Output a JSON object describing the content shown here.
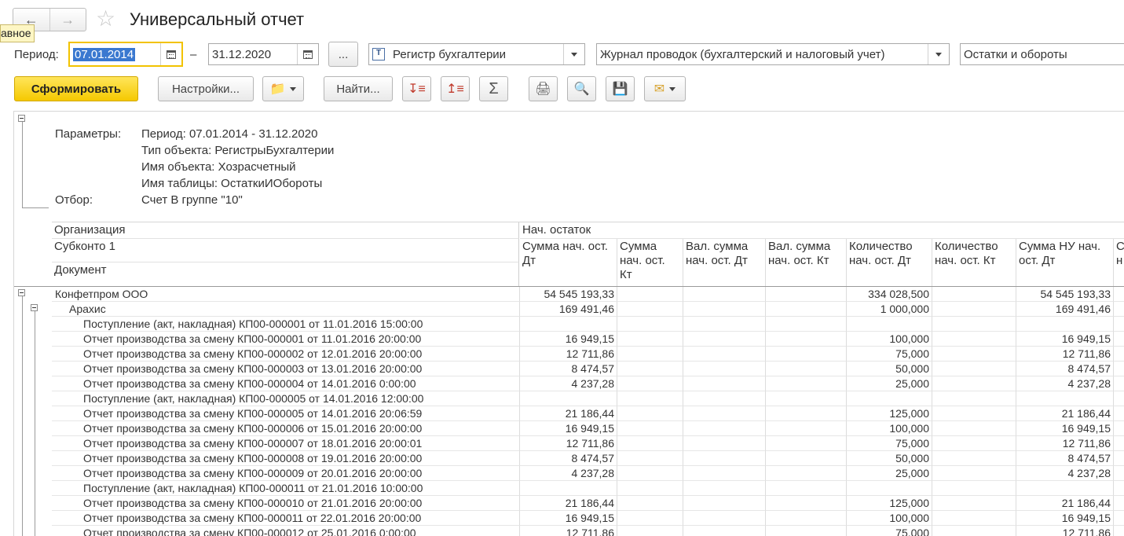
{
  "window": {
    "title": "Универсальный отчет",
    "tooltip": "авное"
  },
  "icons": {
    "back": "arrow-left-icon",
    "forward": "arrow-right-icon",
    "favorite": "star-icon"
  },
  "period": {
    "label": "Период:",
    "from": "07.01.2014",
    "dash": "–",
    "to": "31.12.2020",
    "more_label": "..."
  },
  "selectors": {
    "object_type": "Регистр бухгалтерии",
    "object": "Журнал проводок (бухгалтерский и налоговый учет)",
    "table": "Остатки и обороты"
  },
  "toolbar": {
    "generate": "Сформировать",
    "settings": "Настройки...",
    "find": "Найти..."
  },
  "params": {
    "params_label": "Параметры:",
    "filter_label": "Отбор:",
    "lines": [
      "Период: 07.01.2014 - 31.12.2020",
      "Тип объекта: РегистрыБухгалтерии",
      "Имя объекта: Хозрасчетный",
      "Имя таблицы: ОстаткиИОбороты"
    ],
    "filter": "Счет В группе \"10\""
  },
  "header": {
    "org": "Организация",
    "subkonto": "Субконто 1",
    "document": "Документ",
    "group": "Нач. остаток",
    "columns": [
      "Сумма нач. ост. Дт",
      "Сумма нач. ост. Кт",
      "Вал. сумма нач. ост. Дт",
      "Вал. сумма нач. ост. Кт",
      "Количество нач. ост. Дт",
      "Количество нач. ост. Кт",
      "Сумма НУ нач. ост. Дт",
      "С н"
    ]
  },
  "rows": [
    {
      "name": "Конфетпром ООО",
      "level": 0,
      "sum": "54 545 193,33",
      "qty": "334 028,500",
      "nu": "54 545 193,33"
    },
    {
      "name": "Арахис",
      "level": 1,
      "sum": "169 491,46",
      "qty": "1 000,000",
      "nu": "169 491,46"
    },
    {
      "name": "Поступление (акт, накладная) КП00-000001 от 11.01.2016 15:00:00",
      "level": 2,
      "sum": "",
      "qty": "",
      "nu": ""
    },
    {
      "name": "Отчет производства за смену КП00-000001 от 11.01.2016 20:00:00",
      "level": 2,
      "sum": "16 949,15",
      "qty": "100,000",
      "nu": "16 949,15"
    },
    {
      "name": "Отчет производства за смену КП00-000002 от 12.01.2016 20:00:00",
      "level": 2,
      "sum": "12 711,86",
      "qty": "75,000",
      "nu": "12 711,86"
    },
    {
      "name": "Отчет производства за смену КП00-000003 от 13.01.2016 20:00:00",
      "level": 2,
      "sum": "8 474,57",
      "qty": "50,000",
      "nu": "8 474,57"
    },
    {
      "name": "Отчет производства за смену КП00-000004 от 14.01.2016 0:00:00",
      "level": 2,
      "sum": "4 237,28",
      "qty": "25,000",
      "nu": "4 237,28"
    },
    {
      "name": "Поступление (акт, накладная) КП00-000005 от 14.01.2016 12:00:00",
      "level": 2,
      "sum": "",
      "qty": "",
      "nu": ""
    },
    {
      "name": "Отчет производства за смену КП00-000005 от 14.01.2016 20:06:59",
      "level": 2,
      "sum": "21 186,44",
      "qty": "125,000",
      "nu": "21 186,44"
    },
    {
      "name": "Отчет производства за смену КП00-000006 от 15.01.2016 20:00:00",
      "level": 2,
      "sum": "16 949,15",
      "qty": "100,000",
      "nu": "16 949,15"
    },
    {
      "name": "Отчет производства за смену КП00-000007 от 18.01.2016 20:00:01",
      "level": 2,
      "sum": "12 711,86",
      "qty": "75,000",
      "nu": "12 711,86"
    },
    {
      "name": "Отчет производства за смену КП00-000008 от 19.01.2016 20:00:00",
      "level": 2,
      "sum": "8 474,57",
      "qty": "50,000",
      "nu": "8 474,57"
    },
    {
      "name": "Отчет производства за смену КП00-000009 от 20.01.2016 20:00:00",
      "level": 2,
      "sum": "4 237,28",
      "qty": "25,000",
      "nu": "4 237,28"
    },
    {
      "name": "Поступление (акт, накладная) КП00-000011 от 21.01.2016 10:00:00",
      "level": 2,
      "sum": "",
      "qty": "",
      "nu": ""
    },
    {
      "name": "Отчет производства за смену КП00-000010 от 21.01.2016 20:00:00",
      "level": 2,
      "sum": "21 186,44",
      "qty": "125,000",
      "nu": "21 186,44"
    },
    {
      "name": "Отчет производства за смену КП00-000011 от 22.01.2016 20:00:00",
      "level": 2,
      "sum": "16 949,15",
      "qty": "100,000",
      "nu": "16 949,15"
    },
    {
      "name": "Отчет производства за смену КП00-000012 от 25.01.2016 0:00:00",
      "level": 2,
      "sum": "12 711,86",
      "qty": "75,000",
      "nu": "12 711,86"
    }
  ]
}
